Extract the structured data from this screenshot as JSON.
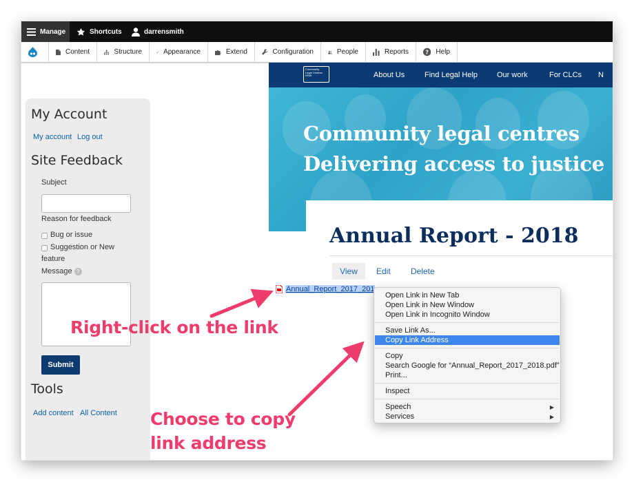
{
  "colors": {
    "toolbar_bg": "#0f0f0f",
    "brand_navy": "#0c3b73",
    "hero_teal": "#3fb7d5",
    "link_blue": "#0a61a4",
    "annotation_pink": "#ee3d6c",
    "menu_highlight": "#3d86eb"
  },
  "toolbar": {
    "manage": "Manage",
    "shortcuts": "Shortcuts",
    "user": "darrensmith"
  },
  "admin_menu": {
    "content": "Content",
    "structure": "Structure",
    "appearance": "Appearance",
    "extend": "Extend",
    "configuration": "Configuration",
    "people": "People",
    "reports": "Reports",
    "help": "Help"
  },
  "sidebar": {
    "my_account_title": "My Account",
    "my_account_link": "My account",
    "log_out_link": "Log out",
    "feedback_title": "Site Feedback",
    "subject_label": "Subject",
    "subject_value": "",
    "reason_label": "Reason for feedback",
    "option_bug": "Bug or issue",
    "option_suggestion_1": "Suggestion or New",
    "option_suggestion_2": "feature",
    "message_label": "Message",
    "message_help": "?",
    "message_value": "",
    "submit_label": "Submit",
    "tools_title": "Tools",
    "add_content_link": "Add content",
    "all_content_link": "All Content"
  },
  "site": {
    "logo_line1": "Community",
    "logo_line2": "Legal Centres",
    "logo_line3": "NSW",
    "nav": [
      "About Us",
      "Find Legal Help",
      "Our work",
      "For CLCs",
      "N"
    ],
    "hero_line1": "Community legal centres",
    "hero_line2": "Delivering access to justice"
  },
  "page": {
    "title": "Annual Report - 2018",
    "tab_view": "View",
    "tab_edit": "Edit",
    "tab_delete": "Delete",
    "file_link": "Annual_Report_2017_201"
  },
  "context_menu": {
    "open_new_tab": "Open Link in New Tab",
    "open_new_window": "Open Link in New Window",
    "open_incognito": "Open Link in Incognito Window",
    "save_link_as": "Save Link As...",
    "copy_link_address": "Copy Link Address",
    "copy": "Copy",
    "search_google": "Search Google for “Annual_Report_2017_2018.pdf”",
    "print": "Print...",
    "inspect": "Inspect",
    "speech": "Speech",
    "services": "Services",
    "submenu_arrow": "▶"
  },
  "annotations": {
    "right_click": "Right-click on the link",
    "choose_line1": "Choose to copy",
    "choose_line2": "link address"
  }
}
